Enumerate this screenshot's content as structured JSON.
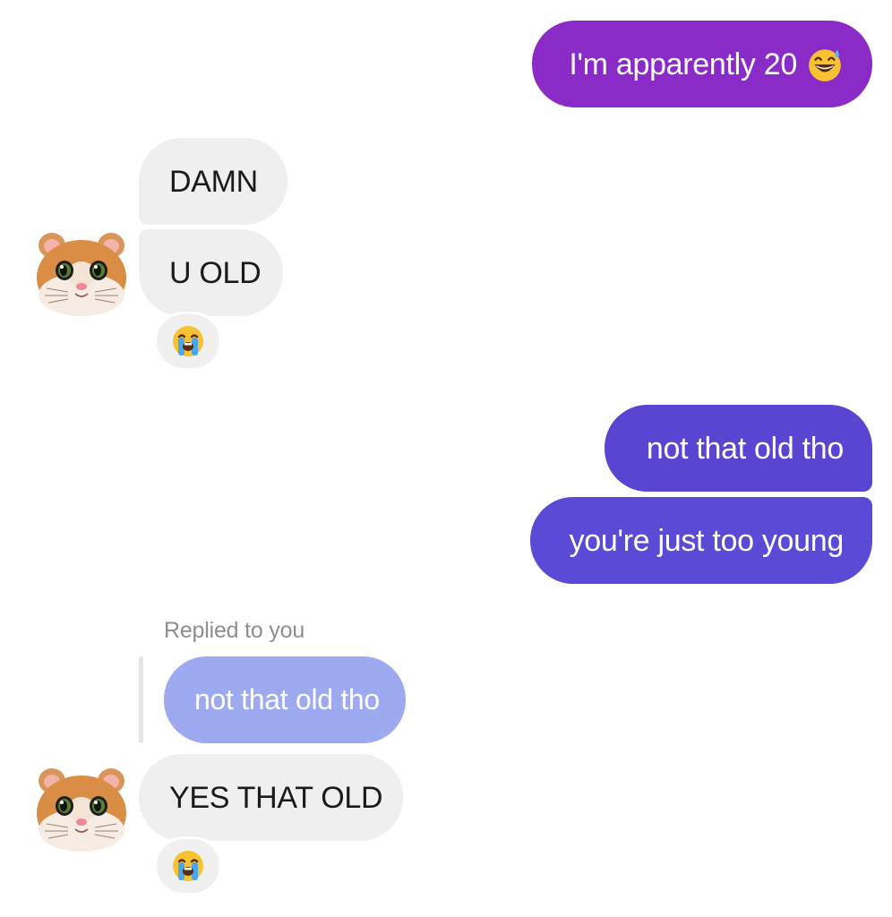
{
  "messages": {
    "out_1": {
      "text": "I'm apparently 20",
      "emoji": "grinning-sweat-icon"
    },
    "in_1": {
      "text": "DAMN"
    },
    "in_2": {
      "text": "U OLD"
    },
    "out_2": {
      "text": "not that old tho"
    },
    "out_3": {
      "text": "you're just too young"
    },
    "reply_label": "Replied to you",
    "quoted": {
      "text": "not that old tho"
    },
    "in_3": {
      "text": "YES THAT OLD"
    }
  },
  "reactions": [
    "loudly-crying-face-icon",
    "loudly-crying-face-icon"
  ],
  "avatars": [
    "hamster-avatar-icon",
    "hamster-avatar-icon"
  ],
  "colors": {
    "outgoing_purple": "#8a2bc8",
    "outgoing_indigo": "#5a45d2",
    "incoming_bg": "#efefef",
    "quoted_bg": "#9eaaf0"
  }
}
